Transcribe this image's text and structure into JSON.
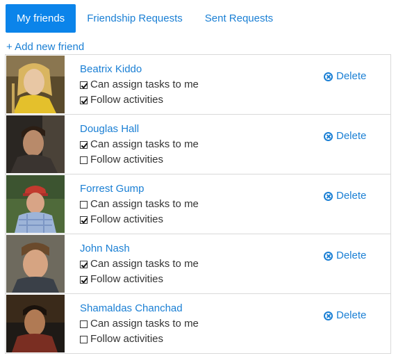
{
  "tabs": [
    {
      "label": "My friends",
      "active": true
    },
    {
      "label": "Friendship Requests",
      "active": false
    },
    {
      "label": "Sent Requests",
      "active": false
    }
  ],
  "add_friend_label": "+ Add new friend",
  "option_labels": {
    "assign": "Can assign tasks to me",
    "follow": "Follow activities"
  },
  "delete_label": "Delete",
  "friends": [
    {
      "name": "Beatrix Kiddo",
      "can_assign": true,
      "follow": true
    },
    {
      "name": "Douglas Hall",
      "can_assign": true,
      "follow": false
    },
    {
      "name": "Forrest Gump",
      "can_assign": false,
      "follow": true
    },
    {
      "name": "John Nash",
      "can_assign": true,
      "follow": true
    },
    {
      "name": "Shamaldas Chanchad",
      "can_assign": false,
      "follow": false
    }
  ],
  "colors": {
    "accent": "#0b84ea",
    "link": "#1a7fd4",
    "border": "#d9d9d9"
  }
}
